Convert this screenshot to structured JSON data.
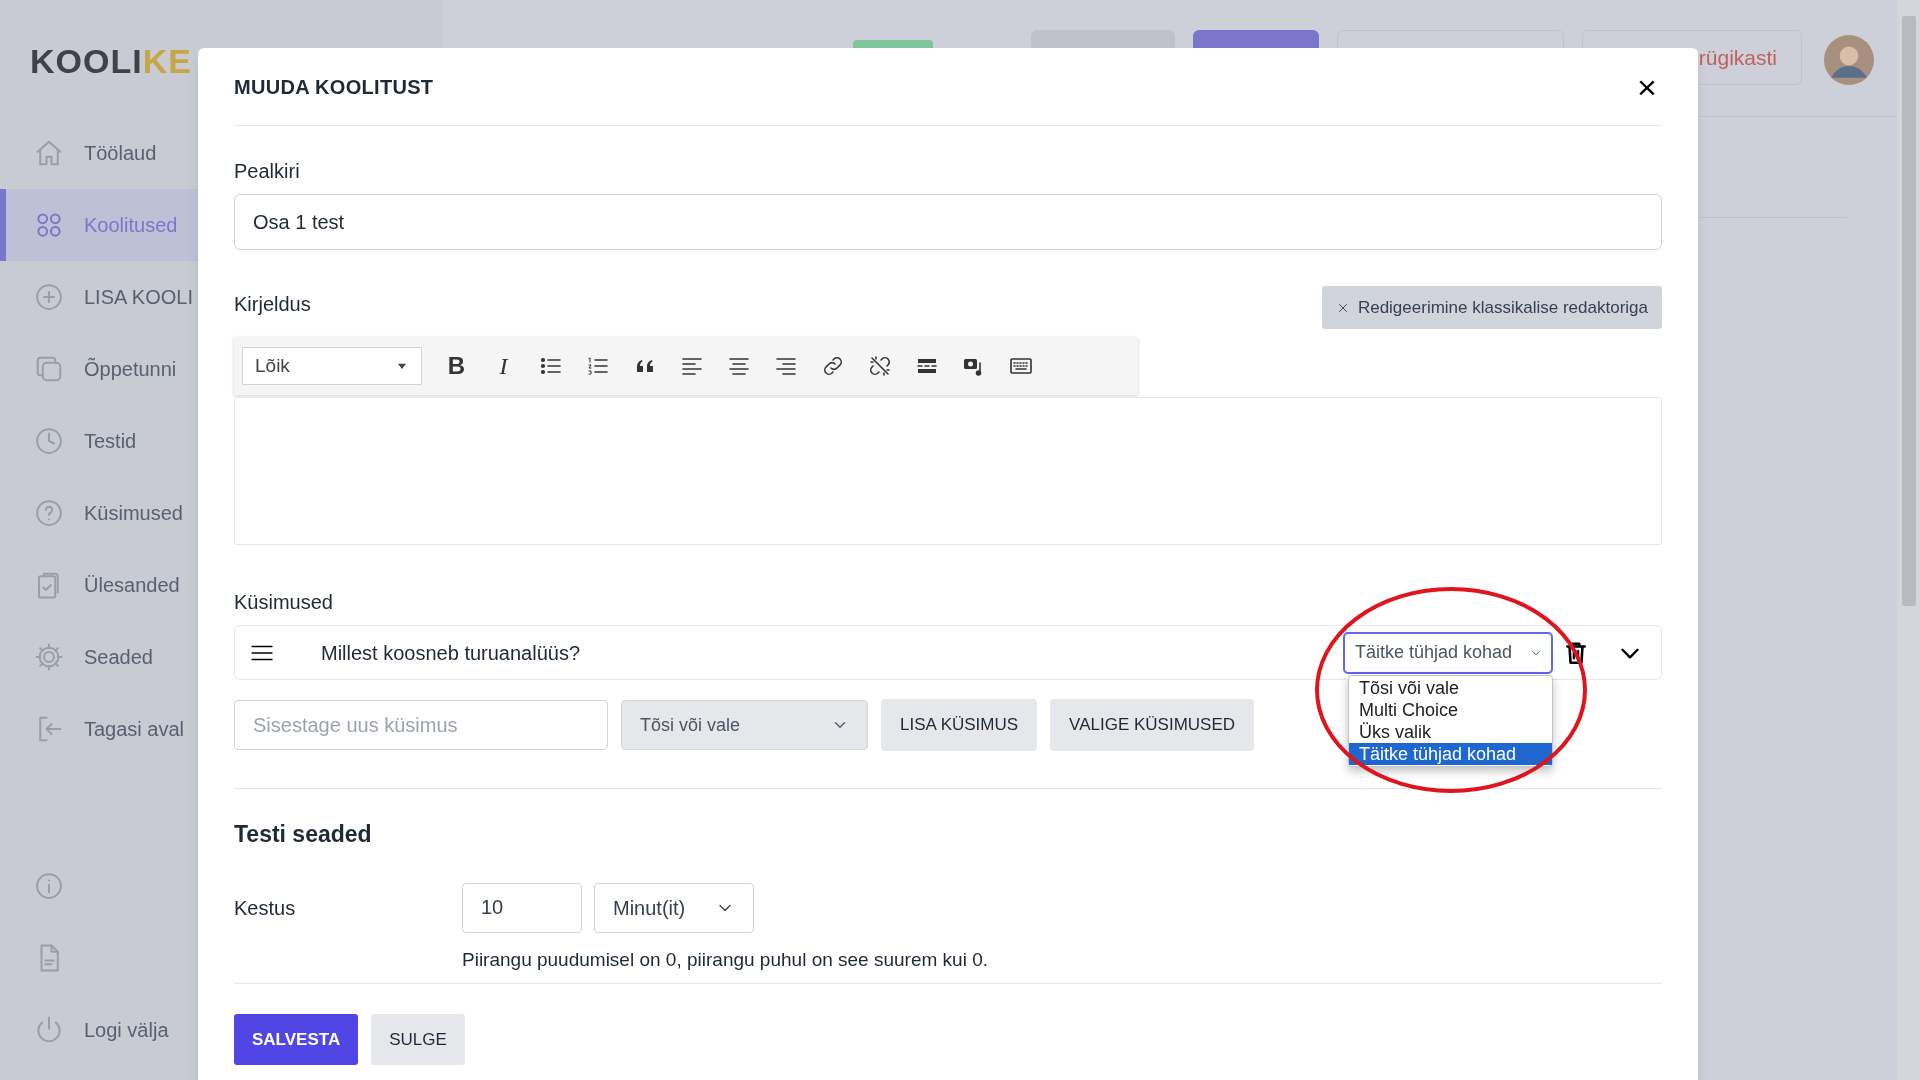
{
  "sidebar": {
    "logo": {
      "dark": "KOOLI",
      "accent": "KE"
    },
    "items": [
      {
        "label": "Töölaud",
        "selected": false
      },
      {
        "label": "Koolitused",
        "selected": true
      },
      {
        "label": "LISA KOOLI",
        "selected": false
      },
      {
        "label": "Õppetunni",
        "selected": false
      },
      {
        "label": "Testid",
        "selected": false
      },
      {
        "label": "Küsimused",
        "selected": false
      },
      {
        "label": "Ülesanded",
        "selected": false
      },
      {
        "label": "Seaded",
        "selected": false
      },
      {
        "label": "Tagasi aval",
        "selected": false
      }
    ],
    "bottom_items": [
      {
        "kind": "info"
      },
      {
        "kind": "document"
      },
      {
        "kind": "logout",
        "label": "Logi välja"
      }
    ]
  },
  "header": {
    "trash_button": "rügikasti"
  },
  "modal": {
    "title": "MUUDA KOOLITUST",
    "close": "×",
    "title_field": {
      "label": "Pealkiri",
      "value": "Osa 1 test"
    },
    "description": {
      "label": "Kirjeldus",
      "classic_button": "Redigeerimine klassikalise redaktoriga",
      "format": "Lõik",
      "toolbar": [
        {
          "kind": "bold",
          "label": "B"
        },
        {
          "kind": "italic",
          "label": "I"
        },
        {
          "kind": "bullets"
        },
        {
          "kind": "numbers"
        },
        {
          "kind": "quote"
        },
        {
          "kind": "align-left"
        },
        {
          "kind": "align-center"
        },
        {
          "kind": "align-right"
        },
        {
          "kind": "link"
        },
        {
          "kind": "unlink"
        },
        {
          "kind": "more"
        },
        {
          "kind": "media"
        },
        {
          "kind": "keyboard"
        }
      ]
    },
    "questions": {
      "label": "Küsimused",
      "items": [
        {
          "text": "Millest koosneb turuanalüüs?",
          "type": "Täitke tühjad kohad",
          "expanded": true,
          "options": [
            {
              "label": "Tõsi või vale",
              "selected": false
            },
            {
              "label": "Multi Choice",
              "selected": false
            },
            {
              "label": "Üks valik",
              "selected": false
            },
            {
              "label": "Täitke tühjad kohad",
              "selected": true
            }
          ]
        }
      ],
      "new_question": {
        "placeholder": "Sisestage uus küsimus",
        "type": "Tõsi või vale"
      },
      "buttons": [
        "LISA KÜSIMUS",
        "VALIGE KÜSIMUSED"
      ]
    },
    "settings": {
      "title": "Testi seaded",
      "duration_label": "Kestus",
      "duration": "10",
      "unit": "Minut(it)",
      "hint": "Piirangu puudumisel on 0, piirangu puhul on see suurem kui 0."
    },
    "buttons": {
      "save": "SALVESTA",
      "close": "SULGE"
    }
  }
}
